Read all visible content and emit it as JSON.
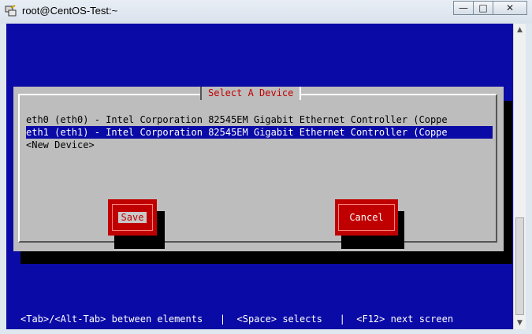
{
  "window": {
    "title": "root@CentOS-Test:~",
    "buttons": {
      "minimize": "▭",
      "maximize": "□",
      "close": "✕"
    }
  },
  "dialog": {
    "title": "Select A Device",
    "items": [
      {
        "label": "eth0 (eth0) - Intel Corporation 82545EM Gigabit Ethernet Controller (Coppe",
        "selected": false
      },
      {
        "label": "eth1 (eth1) - Intel Corporation 82545EM Gigabit Ethernet Controller (Coppe",
        "selected": true
      },
      {
        "label": "<New Device>",
        "selected": false
      }
    ],
    "save_label": "Save",
    "cancel_label": "Cancel"
  },
  "status": {
    "text": "<Tab>/<Alt-Tab> between elements   |  <Space> selects   |  <F12> next screen"
  },
  "colors": {
    "terminal_bg": "#0a0aa6",
    "dialog_bg": "#bdbdbd",
    "accent_red": "#c00000",
    "selection_bg": "#0a0aa6"
  },
  "icons": [
    "putty-icon",
    "minimize-icon",
    "maximize-icon",
    "close-icon",
    "scroll-up-icon",
    "scroll-down-icon"
  ]
}
